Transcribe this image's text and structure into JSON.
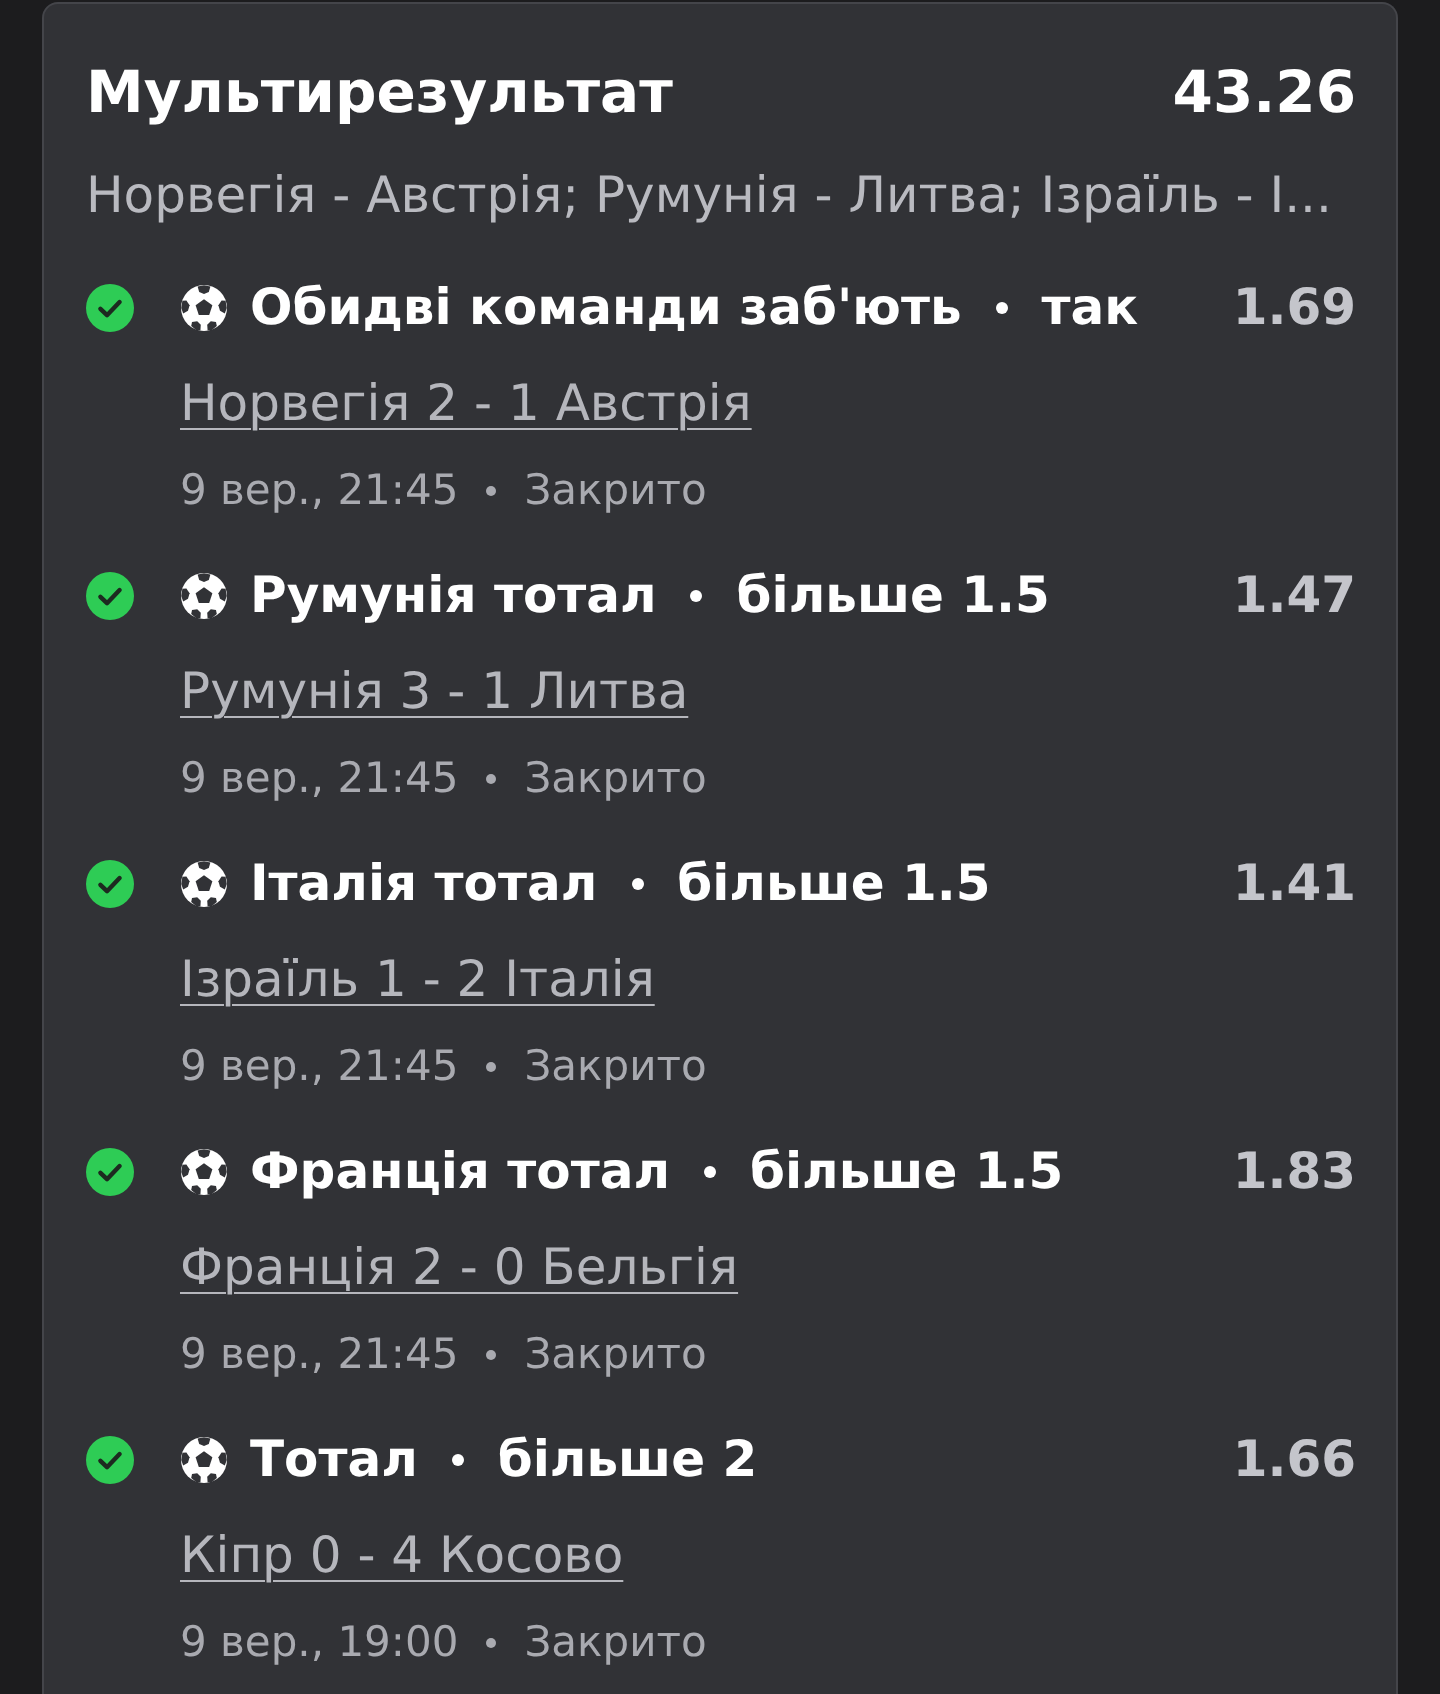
{
  "bet": {
    "title": "Мультирезультат",
    "total_odds": "43.26",
    "events_summary": "Норвегія - Австрія; Румунія - Литва; Ізраїль - І..."
  },
  "legs": [
    {
      "won": true,
      "market": "Обидві команди заб'ють",
      "selection": "так",
      "odds": "1.69",
      "match": "Норвегія 2 - 1 Австрія",
      "date": "9 вер., 21:45",
      "status": "Закрито"
    },
    {
      "won": true,
      "market": "Румунія тотал",
      "selection": "більше 1.5",
      "odds": "1.47",
      "match": "Румунія 3 - 1 Литва",
      "date": "9 вер., 21:45",
      "status": "Закрито"
    },
    {
      "won": true,
      "market": "Італія тотал",
      "selection": "більше 1.5",
      "odds": "1.41",
      "match": "Ізраїль 1 - 2 Італія",
      "date": "9 вер., 21:45",
      "status": "Закрито"
    },
    {
      "won": true,
      "market": "Франція тотал",
      "selection": "більше 1.5",
      "odds": "1.83",
      "match": "Франція 2 - 0 Бельгія",
      "date": "9 вер., 21:45",
      "status": "Закрито"
    },
    {
      "won": true,
      "market": "Тотал",
      "selection": "більше 2",
      "odds": "1.66",
      "match": "Кіпр 0 - 4 Косово",
      "date": "9 вер., 19:00",
      "status": "Закрито"
    }
  ]
}
